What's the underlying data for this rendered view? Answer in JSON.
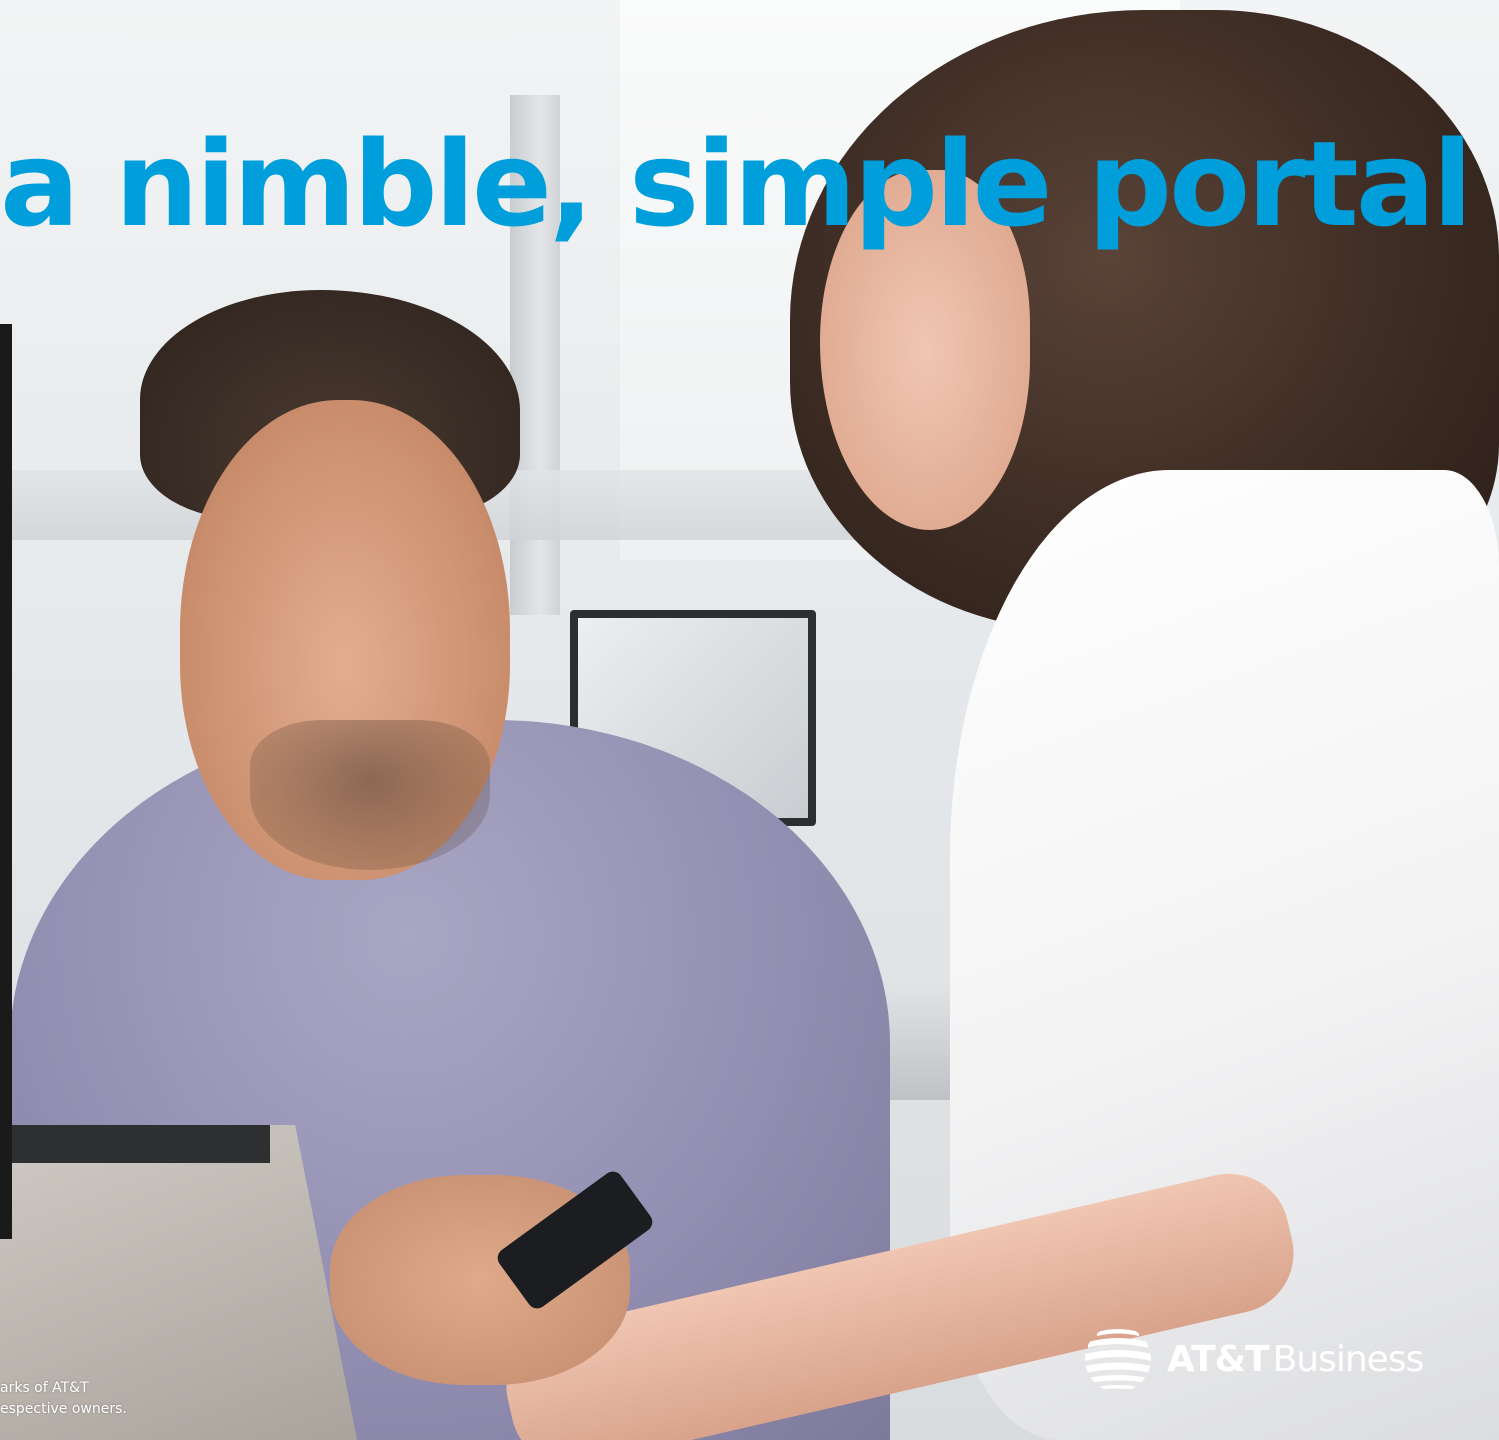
{
  "headline": "a nimble, simple portal",
  "legal": {
    "line1": "arks of AT&T",
    "line2": "espective owners."
  },
  "brand": {
    "logo_icon": "att-globe-icon",
    "name_bold": "AT&T",
    "name_light": "Business"
  },
  "colors": {
    "headline": "#009fdb",
    "brand_text": "#ffffff"
  }
}
